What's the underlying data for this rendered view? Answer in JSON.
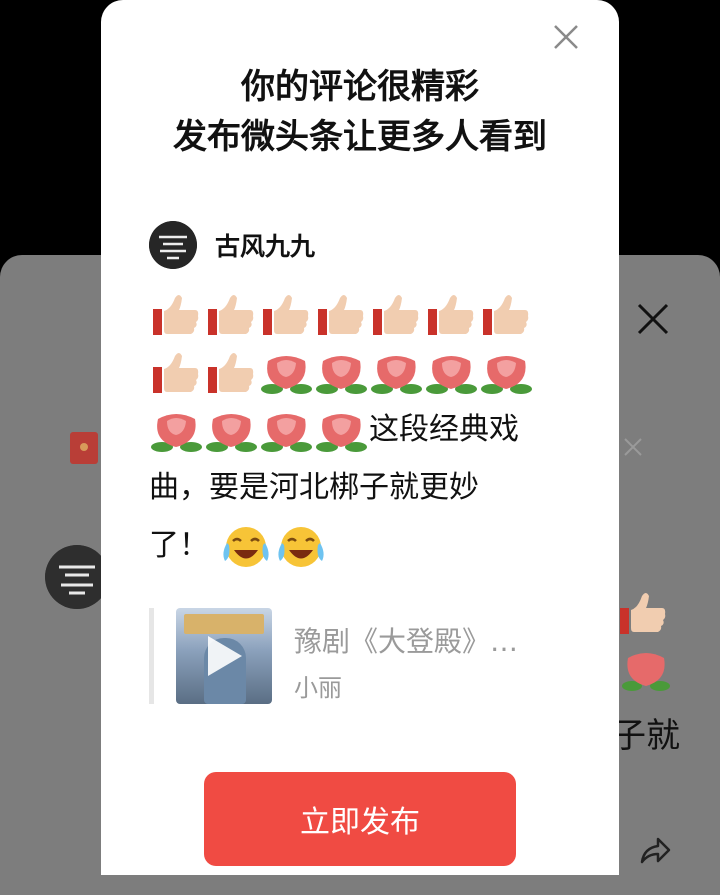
{
  "dialog": {
    "title_line1": "你的评论很精彩",
    "title_line2": "发布微头条让更多人看到",
    "author_name": "古风九九",
    "comment_text_1": "这段经典戏",
    "comment_text_2": "曲，要是河北梆子就更妙",
    "comment_text_3": "了！",
    "quote": {
      "title": "豫剧《大登殿》…",
      "author": "小丽"
    },
    "publish_button": "立即发布",
    "emoji_sequence": [
      "thumbs-up x9",
      "rose x9",
      "laughing-crying x2"
    ]
  },
  "background": {
    "text_fragment": "子就"
  },
  "colors": {
    "accent": "#f04b43",
    "overlay": "#7d7d7d",
    "muted_text": "#9a9a9a"
  }
}
